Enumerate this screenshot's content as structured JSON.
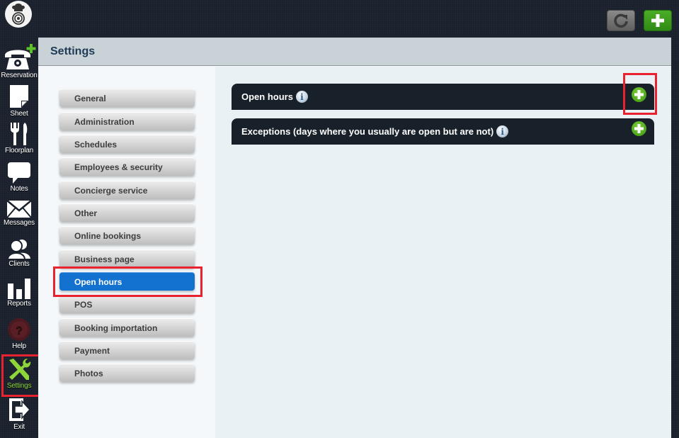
{
  "app": {
    "logo_icon": "chef-logo-icon",
    "toolbar": {
      "refresh_icon": "refresh-icon",
      "add_icon": "plus-icon",
      "colors": {
        "add": "#3a9a1c",
        "refresh": "#707070"
      }
    }
  },
  "sidebar": {
    "items": [
      {
        "label": "Reservation",
        "icon": "phone-plus-icon"
      },
      {
        "label": "Sheet",
        "icon": "sheet-icon"
      },
      {
        "label": "Floorplan",
        "icon": "fork-knife-icon"
      },
      {
        "label": "Notes",
        "icon": "speech-bubble-icon"
      },
      {
        "label": "Messages",
        "icon": "envelope-icon"
      },
      {
        "label": "Clients",
        "icon": "users-icon"
      },
      {
        "label": "Reports",
        "icon": "bar-chart-icon"
      },
      {
        "label": "Help",
        "icon": "help-icon"
      },
      {
        "label": "Settings",
        "icon": "tools-icon",
        "active": true
      },
      {
        "label": "Exit",
        "icon": "exit-arrow-icon"
      }
    ],
    "active_color": "#8ed639"
  },
  "page": {
    "title": "Settings"
  },
  "settings_menu": {
    "items": [
      {
        "label": "General"
      },
      {
        "label": "Administration"
      },
      {
        "label": "Schedules"
      },
      {
        "label": "Employees & security"
      },
      {
        "label": "Concierge service"
      },
      {
        "label": "Other"
      },
      {
        "label": "Online bookings"
      },
      {
        "label": "Business page"
      },
      {
        "label": "Open hours",
        "active": true
      },
      {
        "label": "POS"
      },
      {
        "label": "Booking importation"
      },
      {
        "label": "Payment"
      },
      {
        "label": "Photos"
      }
    ],
    "active_color": "#1372d0"
  },
  "content": {
    "sections": [
      {
        "title": "Open hours",
        "info_icon": "info-icon",
        "add_icon": "plus-circle-icon"
      },
      {
        "title": "Exceptions (days where you usually are open but are not)",
        "info_icon": "info-icon",
        "add_icon": "plus-circle-icon"
      }
    ]
  },
  "annotations": {
    "highlight_color": "#e8232f"
  }
}
